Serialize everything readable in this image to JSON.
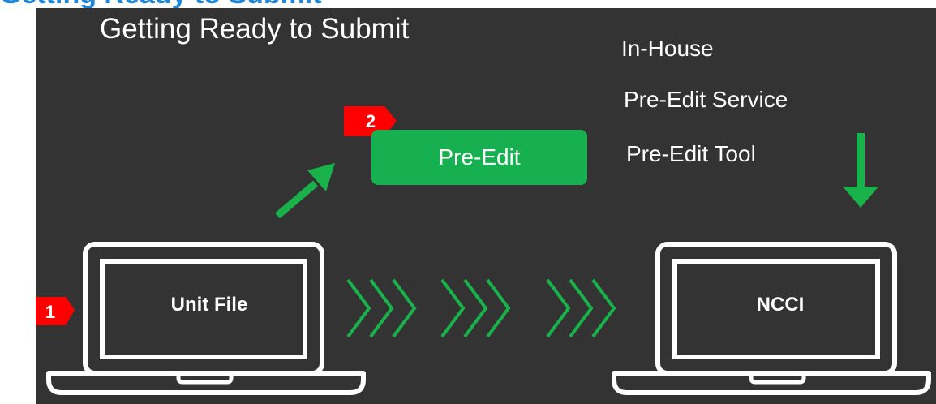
{
  "top_heading": "Getting Ready to Submit",
  "slide": {
    "title": "Getting Ready to Submit",
    "options": [
      "In-House",
      "Pre-Edit Service",
      "Pre-Edit Tool"
    ],
    "preedit_label": "Pre-Edit",
    "left_device_label": "Unit File",
    "right_device_label": "NCCI",
    "marker_1": "1",
    "marker_2": "2"
  },
  "colors": {
    "slide_bg": "#333333",
    "accent_green": "#17b051",
    "marker_red": "#ff0000",
    "heading_blue": "#1f86d8",
    "outline": "#ffffff"
  },
  "icons": [
    "laptop-icon",
    "arrow-up-right-icon",
    "arrow-down-icon",
    "chevron-right-icon"
  ]
}
